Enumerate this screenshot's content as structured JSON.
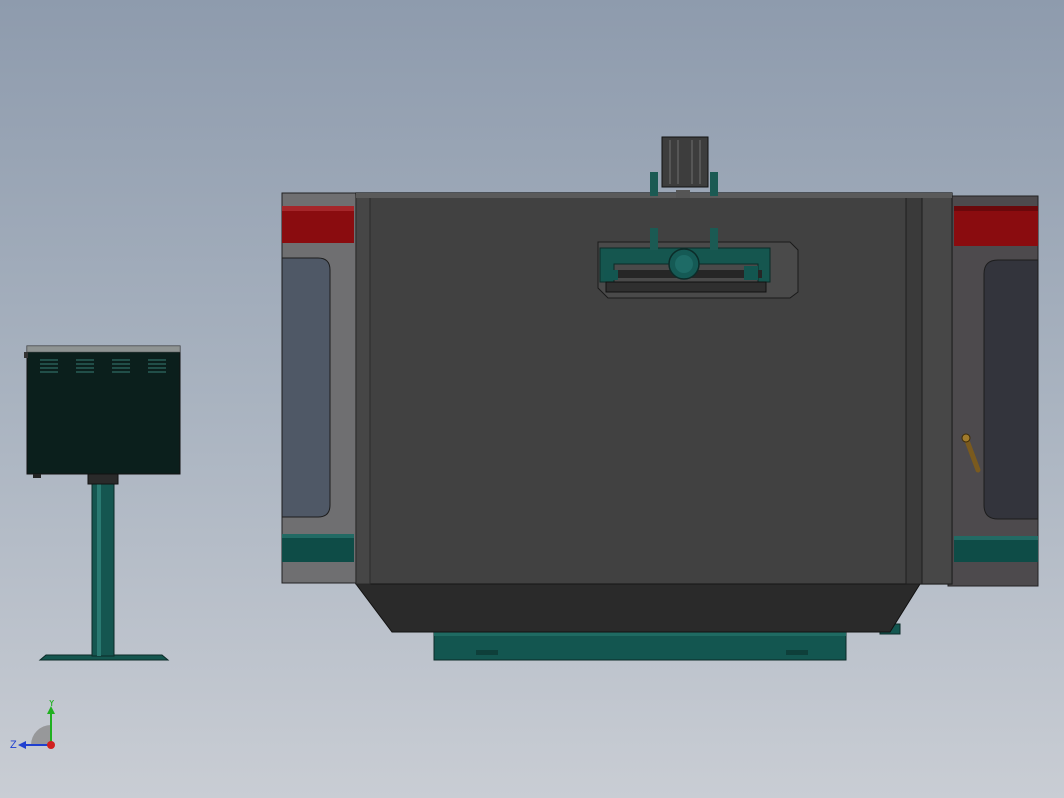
{
  "triad": {
    "x_label": "",
    "y_label": "Y",
    "z_label": "Z"
  },
  "colors": {
    "background_top": "#8e9bad",
    "background_bottom": "#c9cdd4",
    "enclosure": "#414141",
    "accent_teal": "#0e4c47",
    "accent_red": "#8a0c0f",
    "panel_dark": "#0b1f1c"
  },
  "components": [
    {
      "name": "control-cabinet",
      "icon": "control-cabinet-icon"
    },
    {
      "name": "machine-enclosure",
      "icon": "enclosure-icon"
    },
    {
      "name": "left-door",
      "icon": "door-icon"
    },
    {
      "name": "right-door",
      "icon": "door-icon"
    },
    {
      "name": "spindle-motor",
      "icon": "motor-icon"
    }
  ]
}
